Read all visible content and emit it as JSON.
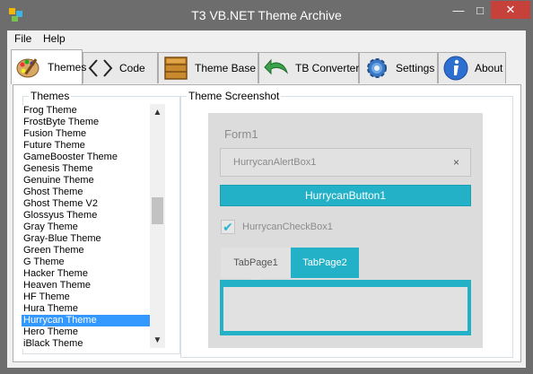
{
  "window": {
    "title": "T3 VB.NET Theme Archive",
    "minimize": "—",
    "maximize": "□",
    "close": "✕"
  },
  "menu": [
    "File",
    "Help"
  ],
  "tabs": [
    {
      "label": "Themes",
      "icon": "palette-icon",
      "active": true
    },
    {
      "label": "Code",
      "icon": "code-brackets-icon",
      "active": false
    },
    {
      "label": "Theme Base",
      "icon": "crate-icon",
      "active": false
    },
    {
      "label": "TB Converter",
      "icon": "arrow-back-icon",
      "active": false
    },
    {
      "label": "Settings",
      "icon": "gear-icon",
      "active": false
    },
    {
      "label": "About",
      "icon": "info-icon",
      "active": false
    }
  ],
  "themes_group": {
    "label": "Themes",
    "items": [
      "Frog Theme",
      "FrostByte Theme",
      "Fusion Theme",
      "Future Theme",
      "GameBooster Theme",
      "Genesis Theme",
      "Genuine Theme",
      "Ghost Theme",
      "Ghost Theme V2",
      "Glossyus Theme",
      "Gray Theme",
      "Gray-Blue Theme",
      "Green Theme",
      "G Theme",
      "Hacker Theme",
      "Heaven Theme",
      "HF Theme",
      "Hura Theme",
      "Hurrycan Theme",
      "Hero Theme",
      "iBlack Theme"
    ],
    "selected": "Hurrycan Theme"
  },
  "screenshot_group": {
    "label": "Theme Screenshot",
    "form_title": "Form1",
    "alert_text": "HurrycanAlertBox1",
    "alert_close": "×",
    "button_text": "HurrycanButton1",
    "checkbox_label": "HurrycanCheckBox1",
    "checkbox_checked": true,
    "tab1": "TabPage1",
    "tab2": "TabPage2"
  },
  "colors": {
    "accent": "#23b1c8",
    "selection": "#3399ff",
    "close_button": "#c7413b",
    "title_bar": "#6d6d6d"
  }
}
